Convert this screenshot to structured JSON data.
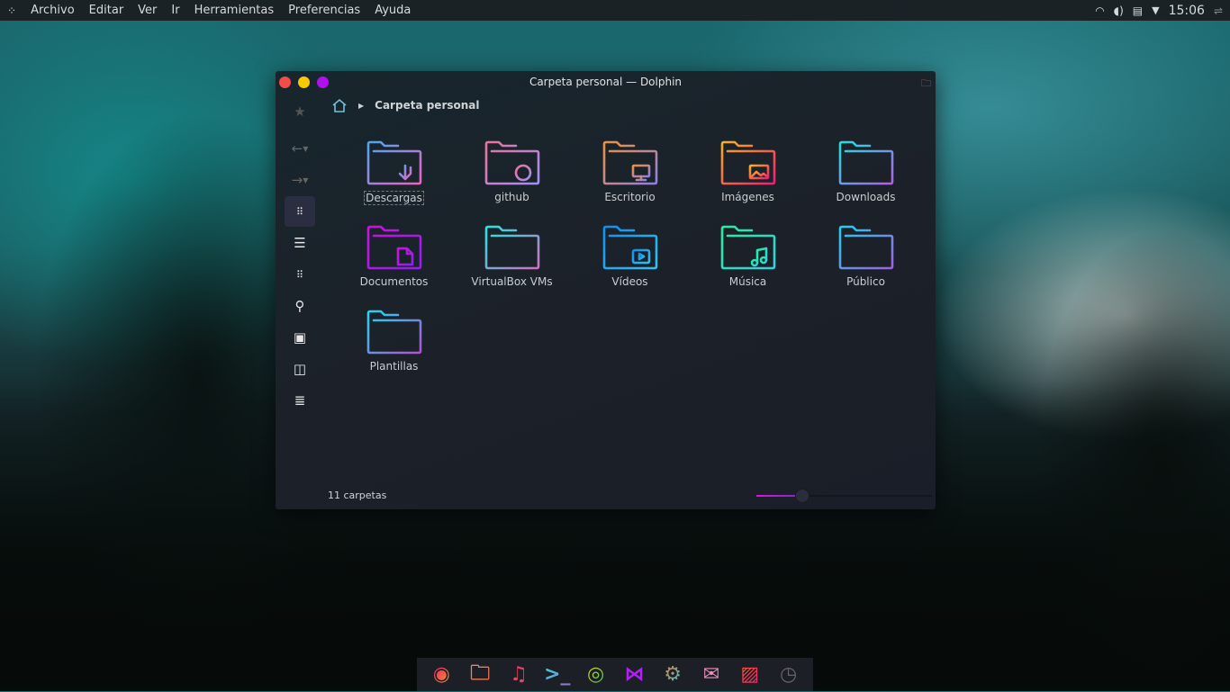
{
  "menubar": {
    "items": [
      "Archivo",
      "Editar",
      "Ver",
      "Ir",
      "Herramientas",
      "Preferencias",
      "Ayuda"
    ],
    "clock": "15:06"
  },
  "window": {
    "title": "Carpeta personal — Dolphin",
    "breadcrumb": "Carpeta personal",
    "status": "11 carpetas",
    "zoom_level_percent": 26,
    "buttons": {
      "close": "#f44b4b",
      "minimize": "#f8c800",
      "maximize": "#b010f0"
    }
  },
  "folders": [
    {
      "label": "Descargas",
      "emblem": "download",
      "colors": [
        "#4aa8f0",
        "#f060c0"
      ]
    },
    {
      "label": "github",
      "emblem": "github",
      "colors": [
        "#f070a0",
        "#a090f0"
      ]
    },
    {
      "label": "Escritorio",
      "emblem": "desktop",
      "colors": [
        "#f09040",
        "#9080e0"
      ]
    },
    {
      "label": "Imágenes",
      "emblem": "image",
      "colors": [
        "#f8b020",
        "#f02070"
      ]
    },
    {
      "label": "Downloads",
      "emblem": "",
      "colors": [
        "#20e0e0",
        "#b060e0"
      ]
    },
    {
      "label": "Documentos",
      "emblem": "document",
      "colors": [
        "#d010e0",
        "#9020f0"
      ]
    },
    {
      "label": "VirtualBox VMs",
      "emblem": "",
      "colors": [
        "#20e8e0",
        "#d070c0"
      ]
    },
    {
      "label": "Vídeos",
      "emblem": "video",
      "colors": [
        "#1090f0",
        "#30c0f0"
      ]
    },
    {
      "label": "Música",
      "emblem": "music",
      "colors": [
        "#20f0a0",
        "#30d0e0"
      ]
    },
    {
      "label": "Público",
      "emblem": "",
      "colors": [
        "#20d0f0",
        "#a060e0"
      ]
    },
    {
      "label": "Plantillas",
      "emblem": "",
      "colors": [
        "#20d8f0",
        "#b050d0"
      ]
    }
  ],
  "dock": [
    "firefox",
    "files",
    "music",
    "terminal",
    "chrome",
    "vscode",
    "settings",
    "mail",
    "image-viewer",
    "clock"
  ]
}
